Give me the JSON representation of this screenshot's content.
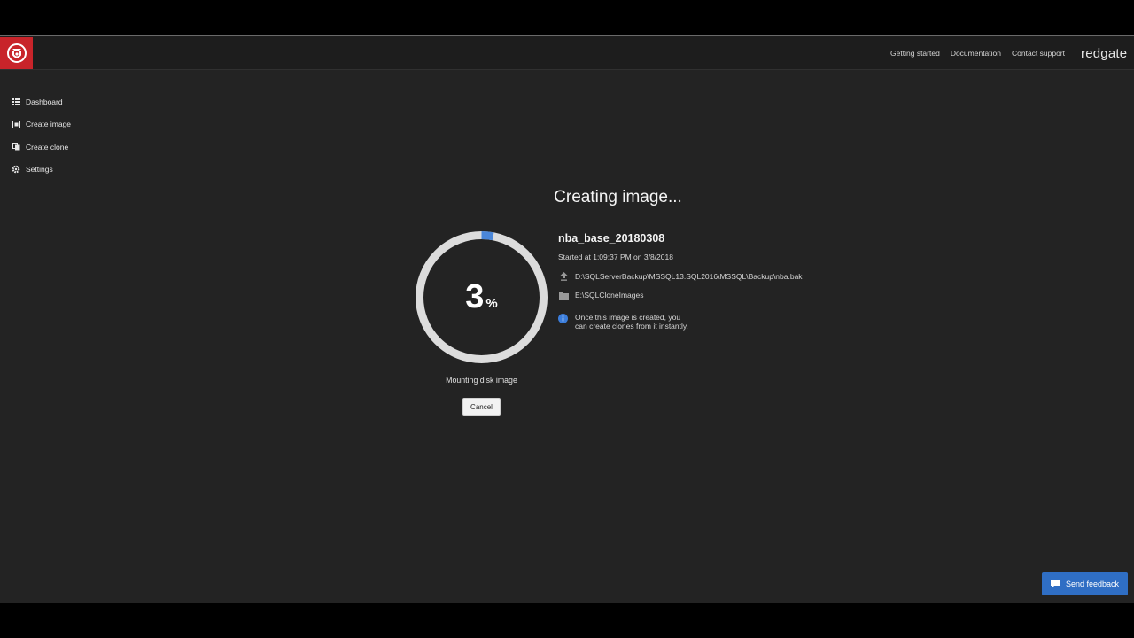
{
  "header": {
    "links": [
      "Getting started",
      "Documentation",
      "Contact support"
    ],
    "brand": "redgate"
  },
  "sidebar": {
    "items": [
      {
        "label": "Dashboard",
        "icon": "list-icon"
      },
      {
        "label": "Create image",
        "icon": "image-icon"
      },
      {
        "label": "Create clone",
        "icon": "copy-icon"
      },
      {
        "label": "Settings",
        "icon": "gear-icon"
      }
    ]
  },
  "main": {
    "heading": "Creating image...",
    "progress": {
      "value": 3,
      "unit": "%",
      "status": "Mounting disk image"
    },
    "cancel_label": "Cancel",
    "image": {
      "name": "nba_base_20180308",
      "started": "Started at 1:09:37 PM on 3/8/2018",
      "source": "D:\\SQLServerBackup\\MSSQL13.SQL2016\\MSSQL\\Backup\\nba.bak",
      "destination": "E:\\SQLCloneImages",
      "info_line1": "Once this image is created, you",
      "info_line2": "can create clones from it instantly."
    }
  },
  "feedback": {
    "label": "Send feedback"
  },
  "colors": {
    "accent": "#2f6ec4",
    "logo": "#c8242a",
    "progress": "#4a86d8",
    "track": "#dcdcdc"
  }
}
